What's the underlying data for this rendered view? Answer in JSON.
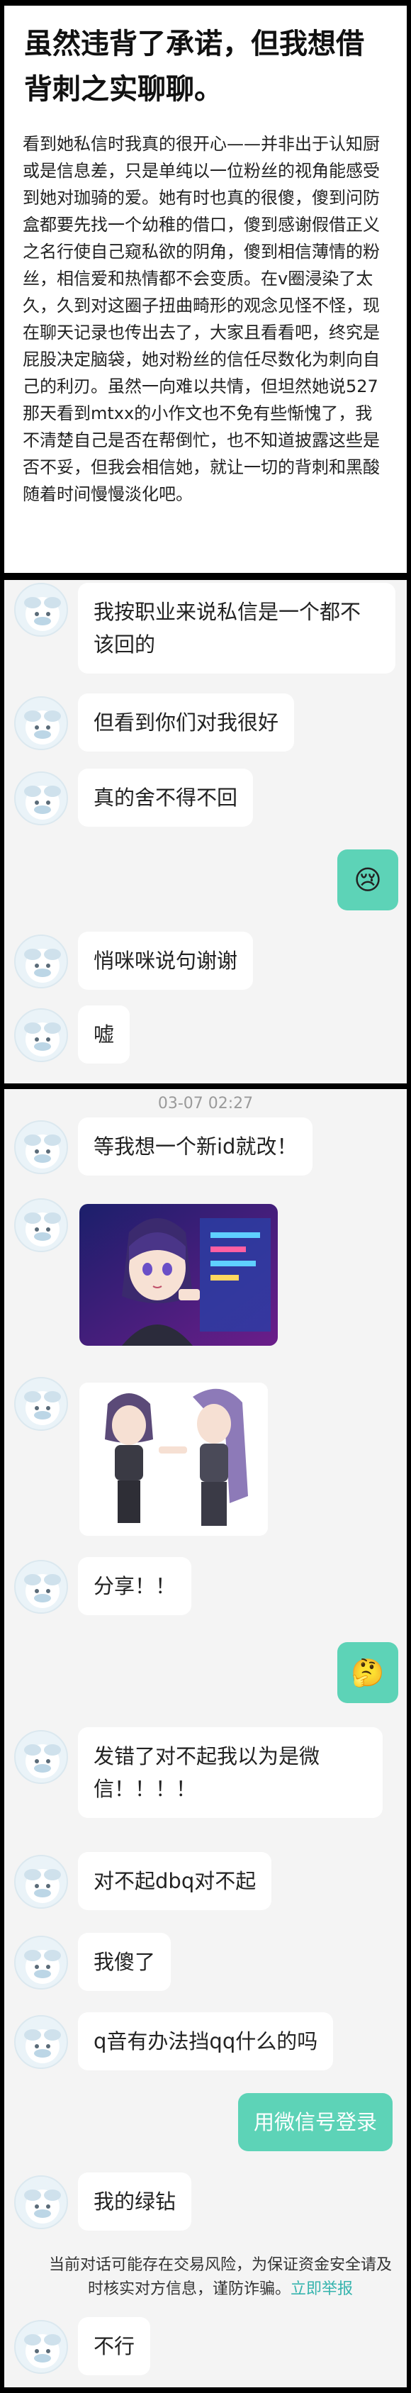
{
  "post": {
    "title": "虽然违背了承诺，但我想借背刺之实聊聊。",
    "body": "看到她私信时我真的很开心——并非出于认知厨或是信息差，只是单纯以一位粉丝的视角能感受到她对珈骑的爱。她有时也真的很傻，傻到问防盒都要先找一个幼稚的借口，傻到感谢假借正义之名行使自己窥私欲的阴角，傻到相信薄情的粉丝，相信爱和热情都不会变质。在v圈浸染了太久，久到对这圈子扭曲畸形的观念见怪不怪，现在聊天记录也传出去了，大家且看看吧，终究是屁股决定脑袋，她对粉丝的信任尽数化为刺向自己的利刃。虽然一向难以共情，但坦然她说527那天看到mtxx的小作文也不免有些惭愧了，我不清楚自己是否在帮倒忙，也不知道披露这些是否不妥，但我会相信她，就让一切的背刺和黑酸随着时间慢慢淡化吧。"
  },
  "chat1": {
    "messages": [
      {
        "text": "我按职业来说私信是一个都不该回的"
      },
      {
        "text": "但看到你们对我很好"
      },
      {
        "text": "真的舍不得不回"
      },
      {
        "emoji": "😢"
      },
      {
        "text": "悄咪咪说句谢谢"
      },
      {
        "text": "嘘"
      }
    ]
  },
  "chat2": {
    "timestamp": "03-07 02:27",
    "messages": [
      {
        "text": "等我想一个新id就改！"
      },
      {
        "text": "分享！！"
      },
      {
        "emoji": "🤔"
      },
      {
        "text": "发错了对不起我以为是微信！！！！"
      },
      {
        "text": "对不起dbq对不起"
      },
      {
        "text": "我傻了"
      },
      {
        "text": "q音有办法挡qq什么的吗"
      },
      {
        "text": "用微信号登录"
      },
      {
        "text": "我的绿钻"
      },
      {
        "text": "不行"
      }
    ],
    "notice": {
      "text": "当前对话可能存在交易风险，为保证资金安全请及时核实对方信息，谨防诈骗。",
      "link": "立即举报"
    }
  },
  "colors": {
    "outgoing": "#5dd3b7",
    "notice_link": "#36b4ae"
  }
}
